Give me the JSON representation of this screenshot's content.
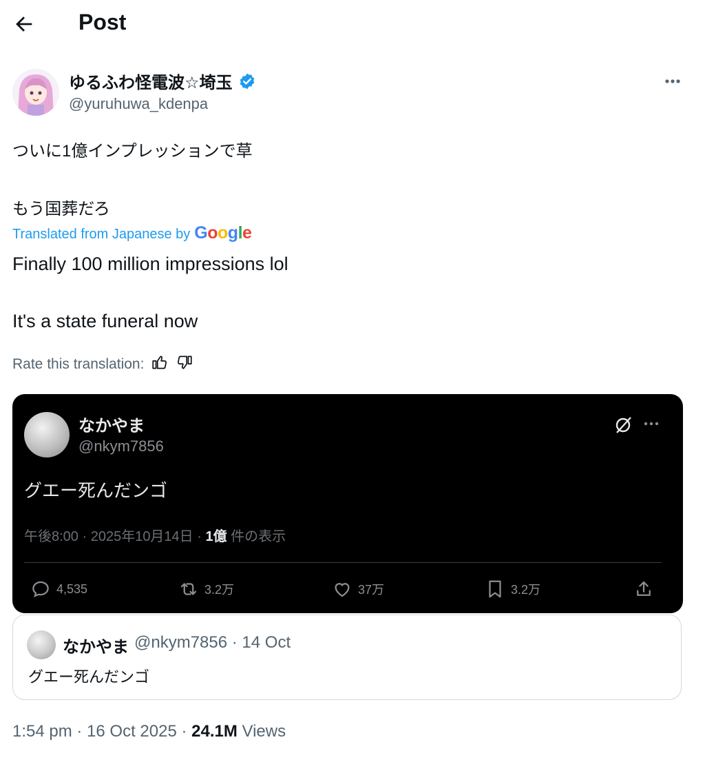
{
  "header": {
    "title": "Post"
  },
  "author": {
    "display_name": "ゆるふわ怪電波☆埼玉",
    "handle": "@yuruhuwa_kdenpa",
    "verified_color": "#1d9bf0"
  },
  "post": {
    "text_line1": "ついに1億インプレッションで草",
    "text_line2": "もう国葬だろ",
    "translated_label": "Translated from Japanese by",
    "translated_provider": "Google",
    "translation_line1": "Finally 100 million impressions lol",
    "translation_line2": "It's a state funeral now",
    "rate_label": "Rate this translation:"
  },
  "embedded_media": {
    "name": "なかやま",
    "handle": "@nkym7856",
    "text": "グエー死んだンゴ",
    "meta_prefix": "午後8:00 · 2025年10月14日 · ",
    "meta_views": "1億",
    "meta_suffix": " 件の表示",
    "stats": {
      "replies": "4,535",
      "reposts": "3.2万",
      "likes": "37万",
      "bookmarks": "3.2万"
    }
  },
  "quote": {
    "name": "なかやま",
    "handle_date": "@nkym7856 · 14 Oct",
    "text": "グエー死んだンゴ"
  },
  "footer": {
    "time_date": "1:54 pm · 16 Oct 2025 · ",
    "views_count": "24.1M",
    "views_label": " Views"
  },
  "colors": {
    "accent": "#1d9bf0",
    "text_primary": "#0f1419",
    "text_secondary": "#536471",
    "media_bg": "#000000"
  }
}
